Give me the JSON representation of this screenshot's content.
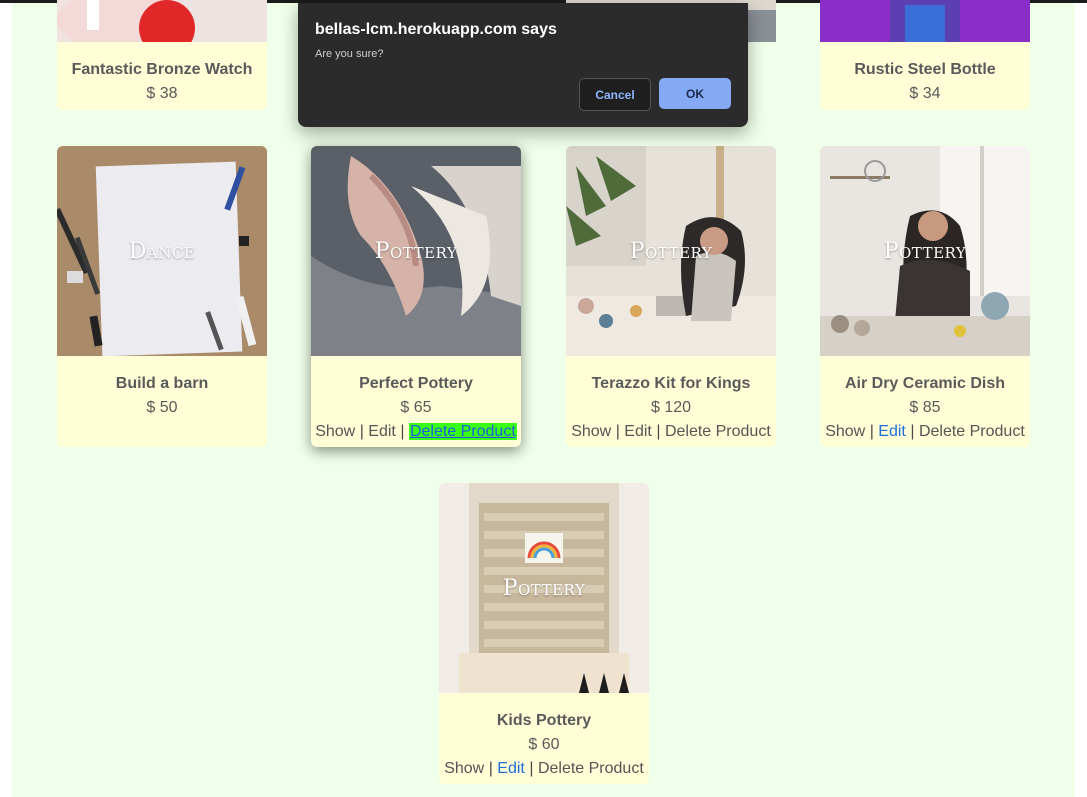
{
  "dialog": {
    "title": "bellas-lcm.herokuapp.com says",
    "message": "Are you sure?",
    "cancel_label": "Cancel",
    "ok_label": "OK"
  },
  "products": [
    {
      "name": "Fantastic Bronze Watch",
      "price": "$ 38"
    },
    {
      "name": "Rustic Steel Bottle",
      "price": "$ 34"
    },
    {
      "name": "Build a barn",
      "price": "$ 50",
      "category": "Dance"
    },
    {
      "name": "Perfect Pottery",
      "price": "$ 65",
      "category": "Pottery"
    },
    {
      "name": "Terazzo Kit for Kings",
      "price": "$ 120",
      "category": "Pottery"
    },
    {
      "name": "Air Dry Ceramic Dish",
      "price": "$ 85",
      "category": "Pottery"
    },
    {
      "name": "Kids Pottery",
      "price": "$ 60",
      "category": "Pottery"
    }
  ],
  "partial_text": "s",
  "actions": {
    "show": "Show",
    "edit": "Edit",
    "delete": "Delete Product",
    "sep": "|"
  },
  "colors": {
    "page_bg": "#efffe9",
    "card_bg": "#fffed7",
    "highlight": "#39ff14",
    "link_blue": "#1e6fd9"
  }
}
